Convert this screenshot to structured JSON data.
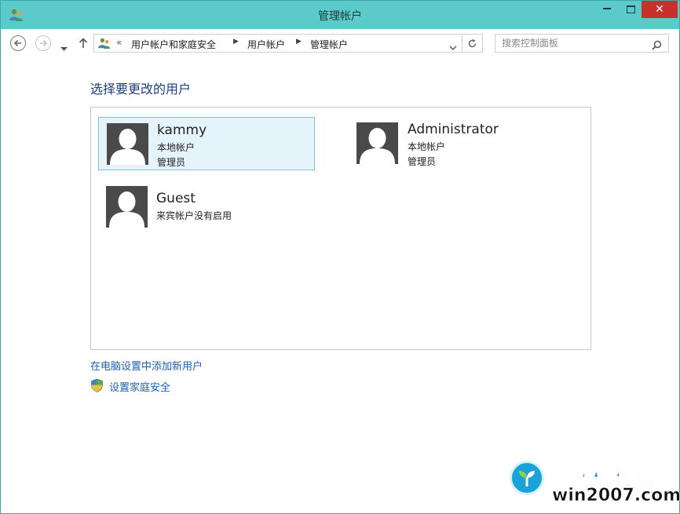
{
  "window": {
    "title": "管理帐户",
    "controls": {
      "minimize": "minimize",
      "maximize": "maximize",
      "close": "✕"
    }
  },
  "nav": {
    "address_overflow": "«",
    "breadcrumbs": [
      "用户帐户和家庭安全",
      "用户帐户",
      "管理帐户"
    ],
    "search_placeholder": "搜索控制面板"
  },
  "main": {
    "heading": "选择要更改的用户",
    "users": [
      {
        "name": "kammy",
        "type": "本地帐户",
        "role": "管理员",
        "selected": true
      },
      {
        "name": "Administrator",
        "type": "本地帐户",
        "role": "管理员",
        "selected": false
      },
      {
        "name": "Guest",
        "type": "来宾帐户没有启用",
        "role": "",
        "selected": false
      }
    ],
    "add_user_link": "在电脑设置中添加新用户",
    "family_safety_link": "设置家庭安全"
  },
  "watermark": {
    "title": "雨林木风",
    "url": "win2007.com"
  },
  "colors": {
    "titlebar": "#5ccaca",
    "link": "#1d5fb0",
    "heading": "#1e3f7a",
    "selection_bg": "#e5f3fb",
    "selection_border": "#7fc4e6",
    "close_button": "#c9302c"
  }
}
